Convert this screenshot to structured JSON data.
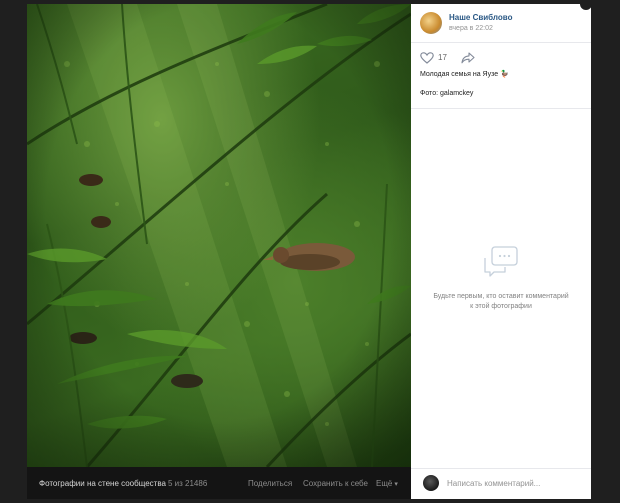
{
  "post": {
    "community_name": "Наше Свиблово",
    "time": "вчера в 22:02",
    "likes": "17",
    "caption": "Молодая семья на Яузе",
    "caption_emoji": "🦆",
    "credit": "Фото: galamckey"
  },
  "comments": {
    "empty_message": "Будьте первым, кто оставит комментарий к этой фотографии",
    "input_placeholder": "Написать комментарий..."
  },
  "footer": {
    "album_title": "Фотографии на стене сообщества",
    "counter": "5 из 21486",
    "share_label": "Поделиться",
    "save_label": "Сохранить к себе",
    "more_label": "Ещё"
  },
  "icons": {
    "like": "heart-outline-icon",
    "share": "share-arrow-icon",
    "empty_comments": "speech-bubble-icon",
    "more": "chevron-down-icon"
  },
  "colors": {
    "link": "#2a5885",
    "background": "#1f1f1f",
    "panel": "#ffffff"
  }
}
